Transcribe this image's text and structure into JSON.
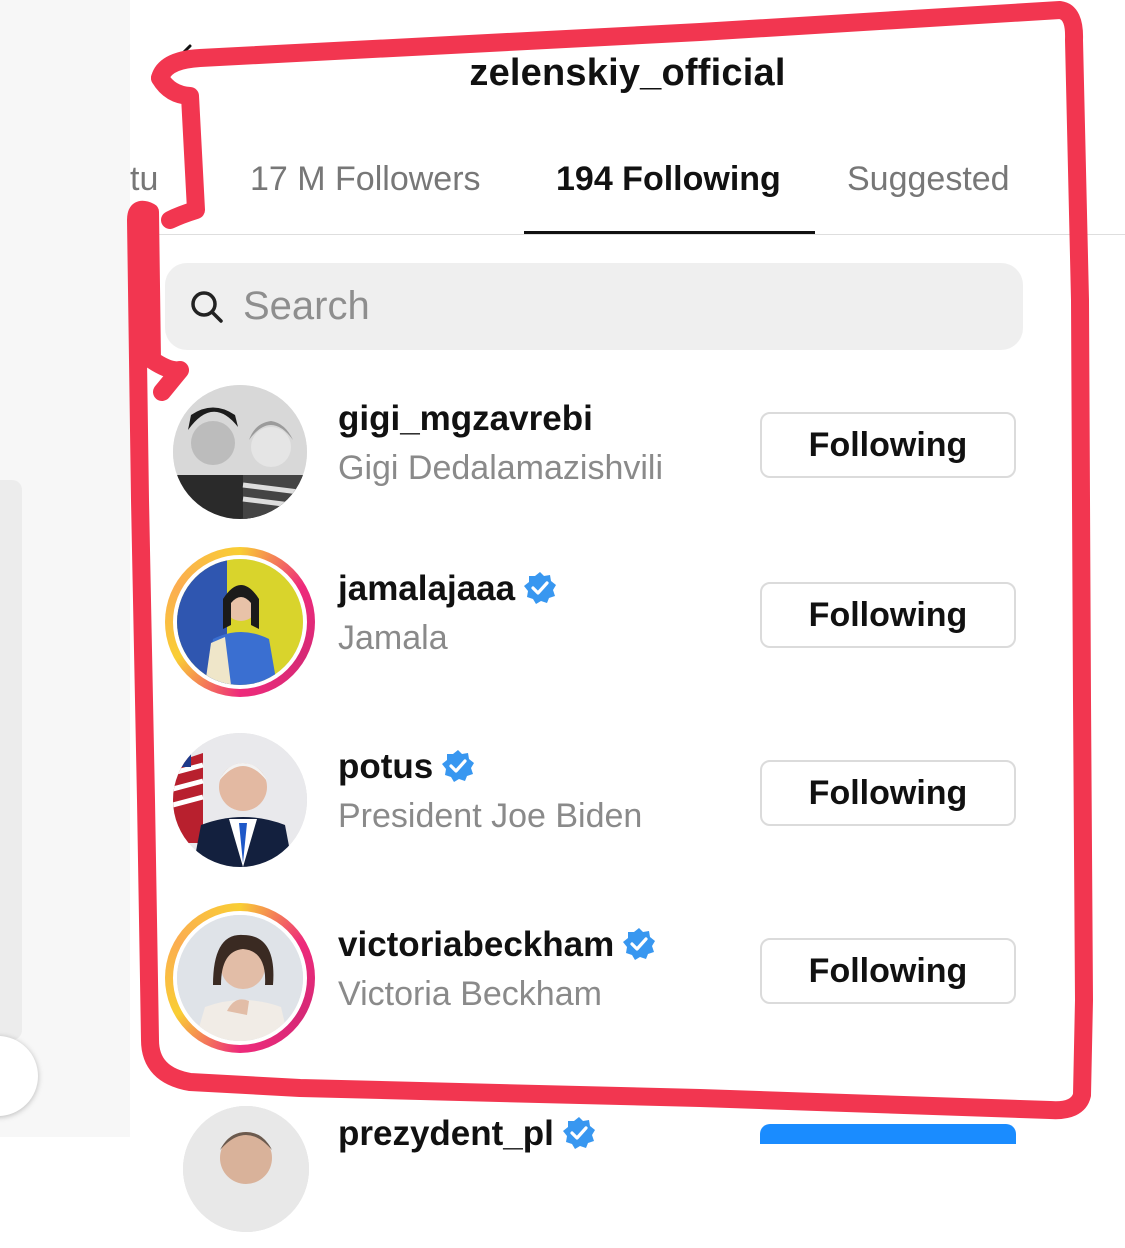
{
  "header": {
    "title": "zelenskiy_official"
  },
  "tabs": [
    {
      "label": "tu"
    },
    {
      "label": "17 M Followers"
    },
    {
      "label": "194 Following",
      "active": true
    },
    {
      "label": "Suggested"
    }
  ],
  "search": {
    "placeholder": "Search"
  },
  "accounts": [
    {
      "username": "gigi_mgzavrebi",
      "full_name": "Gigi Dedalamazishvili",
      "verified": false,
      "story_ring": false,
      "button": "Following"
    },
    {
      "username": "jamalajaaa",
      "full_name": "Jamala",
      "verified": true,
      "story_ring": true,
      "button": "Following"
    },
    {
      "username": "potus",
      "full_name": "President Joe Biden",
      "verified": true,
      "story_ring": false,
      "button": "Following"
    },
    {
      "username": "victoriabeckham",
      "full_name": "Victoria Beckham",
      "verified": true,
      "story_ring": true,
      "button": "Following"
    },
    {
      "username": "prezydent_pl",
      "verified": true,
      "story_ring": false
    }
  ],
  "colors": {
    "verified_blue": "#3897f0",
    "markup_red": "#f23650",
    "follow_blue": "#1a8cff"
  },
  "icons": {
    "back": "back-arrow-icon",
    "search": "search-icon",
    "verified": "verified-badge-icon"
  }
}
